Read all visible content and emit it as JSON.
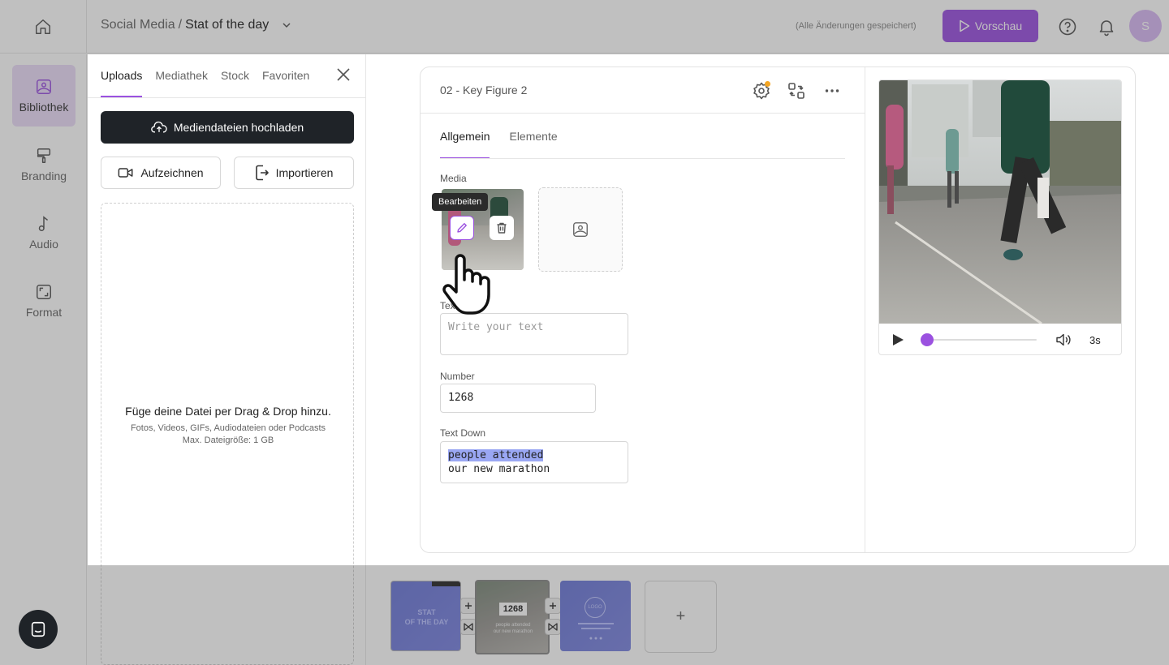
{
  "header": {
    "breadcrumb_parent": "Social Media",
    "breadcrumb_sep": "/",
    "breadcrumb_current": "Stat of the day",
    "saved_status": "(Alle Änderungen gespeichert)",
    "preview_label": "Vorschau",
    "avatar_initial": "S",
    "accent_color": "#9b51e0"
  },
  "leftnav": {
    "items": [
      {
        "label": "Bibliothek",
        "icon": "image-icon",
        "active": true
      },
      {
        "label": "Branding",
        "icon": "paint-roller-icon",
        "active": false
      },
      {
        "label": "Audio",
        "icon": "music-note-icon",
        "active": false
      },
      {
        "label": "Format",
        "icon": "crop-format-icon",
        "active": false
      }
    ]
  },
  "library": {
    "tabs": [
      {
        "label": "Uploads",
        "active": true
      },
      {
        "label": "Mediathek",
        "active": false
      },
      {
        "label": "Stock",
        "active": false
      },
      {
        "label": "Favoriten",
        "active": false
      }
    ],
    "upload_label": "Mediendateien hochladen",
    "record_label": "Aufzeichnen",
    "import_label": "Importieren",
    "dropzone_title": "Füge deine Datei per Drag & Drop hinzu.",
    "dropzone_line1": "Fotos, Videos, GIFs, Audiodateien oder Podcasts",
    "dropzone_line2": "Max. Dateigröße: 1 GB"
  },
  "editor": {
    "scene_title": "02 - Key Figure 2",
    "tabs": [
      {
        "label": "Allgemein",
        "active": true
      },
      {
        "label": "Elemente",
        "active": false
      }
    ],
    "media_label": "Media",
    "tooltip_edit": "Bearbeiten",
    "text_label": "Text",
    "text_placeholder": "Write your text",
    "number_label": "Number",
    "number_value": "1268",
    "text_down_label": "Text Down",
    "text_down_line1": "people attended",
    "text_down_line2": "our new marathon"
  },
  "preview": {
    "duration": "3s",
    "progress_fraction": 0.05
  },
  "timeline": {
    "scene1_text_line1": "STAT",
    "scene1_text_line2": "OF THE DAY",
    "scene2_number": "1268",
    "scene2_line1": "people attended",
    "scene2_line2": "our new marathon",
    "scene3_logo": "LOGO",
    "add_label": "+"
  }
}
